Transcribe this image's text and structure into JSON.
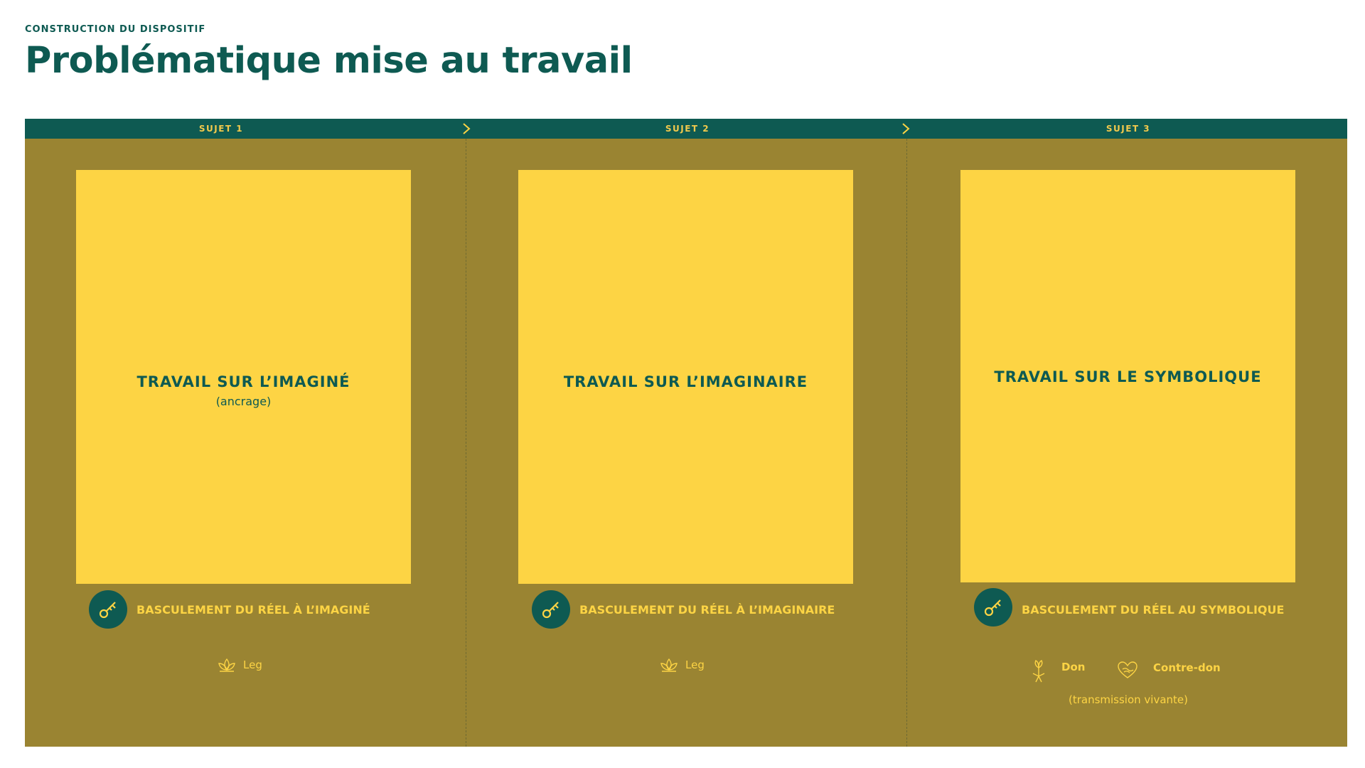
{
  "header": {
    "eyebrow": "CONSTRUCTION DU DISPOSITIF",
    "title": "Problématique mise au travail"
  },
  "columns": [
    {
      "label": "SUJET 1",
      "card_title": "TRAVAIL SUR L’IMAGINÉ",
      "card_subtitle": "(ancrage)",
      "shift": "BASCULEMENT DU RÉEL À L’IMAGINÉ",
      "tags": [
        {
          "icon": "lotus-icon",
          "label": "Leg"
        }
      ]
    },
    {
      "label": "SUJET 2",
      "card_title": "TRAVAIL SUR L’IMAGINAIRE",
      "shift": "BASCULEMENT DU RÉEL À L’IMAGINAIRE",
      "tags": [
        {
          "icon": "lotus-icon",
          "label": "Leg"
        }
      ]
    },
    {
      "label": "SUJET 3",
      "card_title": "TRAVAIL SUR LE SYMBOLIQUE",
      "shift": "BASCULEMENT DU RÉEL AU SYMBOLIQUE",
      "tags": [
        {
          "icon": "plant-person-icon",
          "label": "Don"
        },
        {
          "icon": "heart-hands-icon",
          "label": "Contre-don"
        }
      ],
      "note": "(transmission vivante)"
    }
  ],
  "colors": {
    "teal": "#0e5a52",
    "olive": "#9a8432",
    "yellow": "#fdd444"
  }
}
